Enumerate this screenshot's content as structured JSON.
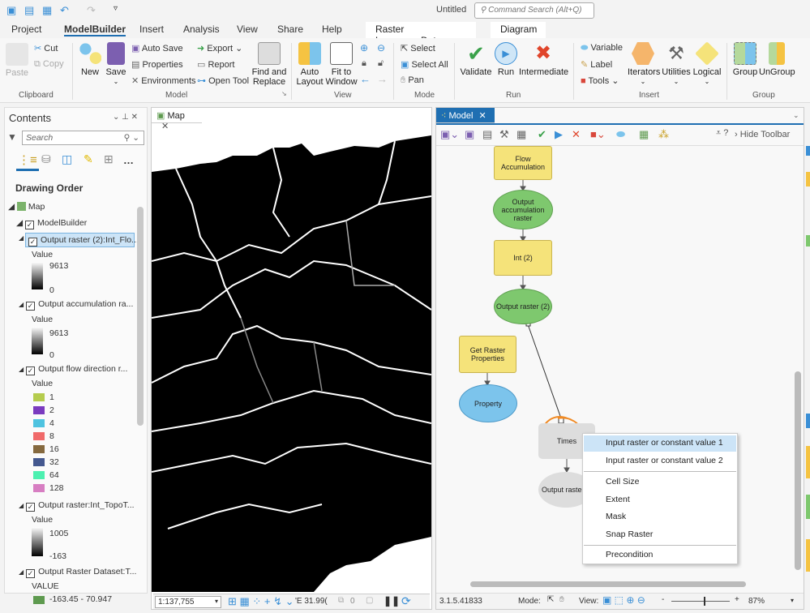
{
  "app": {
    "title": "Untitled",
    "command_search_placeholder": "Command Search (Alt+Q)"
  },
  "tabs": [
    "Project",
    "ModelBuilder",
    "Insert",
    "Analysis",
    "View",
    "Share",
    "Help"
  ],
  "active_tab": "ModelBuilder",
  "context_tabs": [
    "Raster Layer",
    "Data",
    "Diagram"
  ],
  "ribbon": {
    "clipboard": {
      "label": "Clipboard",
      "paste": "Paste",
      "cut": "Cut",
      "copy": "Copy"
    },
    "model": {
      "label": "Model",
      "new": "New",
      "save": "Save",
      "auto_save": "Auto Save",
      "properties": "Properties",
      "environments": "Environments",
      "export": "Export",
      "report": "Report",
      "open_tool": "Open Tool",
      "find_replace_1": "Find and",
      "find_replace_2": "Replace"
    },
    "view": {
      "label": "View",
      "auto_layout_1": "Auto",
      "auto_layout_2": "Layout",
      "fit_1": "Fit to",
      "fit_2": "Window"
    },
    "mode": {
      "label": "Mode",
      "select": "Select",
      "select_all": "Select All",
      "pan": "Pan"
    },
    "run": {
      "label": "Run",
      "validate": "Validate",
      "run": "Run",
      "intermediate": "Intermediate"
    },
    "insert": {
      "label": "Insert",
      "variable": "Variable",
      "label_btn": "Label",
      "tools": "Tools",
      "iterators": "Iterators",
      "utilities": "Utilities",
      "logical": "Logical"
    },
    "group": {
      "label": "Group",
      "group": "Group",
      "ungroup": "UnGroup"
    }
  },
  "contents": {
    "title": "Contents",
    "search_placeholder": "Search",
    "drawing_order": "Drawing Order",
    "map": "Map",
    "group_layer": "ModelBuilder",
    "layers": [
      {
        "name": "Output raster (2):Int_Flo...",
        "field": "Value",
        "max": "9613",
        "min": "0"
      },
      {
        "name": "Output accumulation ra...",
        "field": "Value",
        "max": "9613",
        "min": "0"
      },
      {
        "name": "Output flow direction r...",
        "field": "Value",
        "classes": [
          {
            "label": "1",
            "color": "#b5cc4e"
          },
          {
            "label": "2",
            "color": "#7a3bbf"
          },
          {
            "label": "4",
            "color": "#4ec3e0"
          },
          {
            "label": "8",
            "color": "#f06a6a"
          },
          {
            "label": "16",
            "color": "#85693f"
          },
          {
            "label": "32",
            "color": "#44588f"
          },
          {
            "label": "64",
            "color": "#4cf0b0"
          },
          {
            "label": "128",
            "color": "#d77ec2"
          }
        ]
      },
      {
        "name": "Output raster:Int_TopoT...",
        "field": "Value",
        "max": "1005",
        "min": "-163"
      },
      {
        "name": "Output Raster Dataset:T...",
        "field": "VALUE",
        "classes": [
          {
            "label": "-163.45 - 70.947",
            "color": "#5e9a4f"
          }
        ]
      }
    ]
  },
  "map_pane": {
    "tab": "Map",
    "scale": "1:137,755",
    "coords": "'E 31.99(",
    "selected_count": "0"
  },
  "model_pane": {
    "tab": "Model",
    "hide_toolbar": "Hide Toolbar",
    "version": "3.1.5.41833",
    "mode_label": "Mode:",
    "view_label": "View:",
    "zoom": "87%",
    "nodes": {
      "flow_accumulation": "Flow Accumulation",
      "output_accumulation": "Output accumulation raster",
      "int2": "Int (2)",
      "output_raster2": "Output raster (2)",
      "get_raster_props": "Get Raster Properties",
      "property": "Property",
      "times": "Times",
      "output_raster": "Output raster"
    },
    "context_menu": [
      "Input raster or constant value 1",
      "Input raster or constant value 2",
      "Cell Size",
      "Extent",
      "Mask",
      "Snap Raster",
      "Precondition"
    ],
    "highlighted_item": "Input raster or constant value 1"
  },
  "colors": {
    "accent": "#1f6fb2",
    "tool_node": "#f5e37a",
    "output_node": "#7ec86e",
    "property_node": "#7cc4ec",
    "annotation": "#f08a24"
  }
}
